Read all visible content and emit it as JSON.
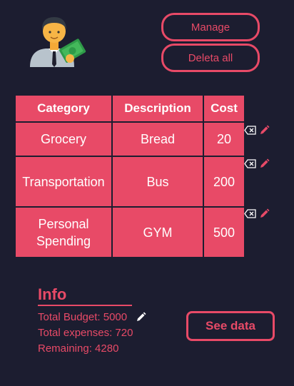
{
  "buttons": {
    "manage_label": "Manage",
    "delete_all_label": "Deleta all",
    "see_data_label": "See data"
  },
  "table": {
    "headers": [
      "Category",
      "Description",
      "Cost"
    ],
    "rows": [
      {
        "category": "Grocery",
        "description": "Bread",
        "cost": "20"
      },
      {
        "category": "Transportation",
        "description": "Bus",
        "cost": "200"
      },
      {
        "category": "Personal Spending",
        "description": "GYM",
        "cost": "500"
      }
    ]
  },
  "info": {
    "title": "Info",
    "budget_label": "Total Budget:",
    "budget_value": "5000",
    "expenses_label": "Total expenses:",
    "expenses_value": "720",
    "remaining_label": "Remaining:",
    "remaining_value": "4280"
  },
  "colors": {
    "background": "#1c1d30",
    "accent": "#e84a67",
    "text": "#ffffff"
  },
  "icons": {
    "avatar": "businessman-with-money-icon",
    "delete": "delete-icon",
    "edit": "pencil-icon"
  }
}
